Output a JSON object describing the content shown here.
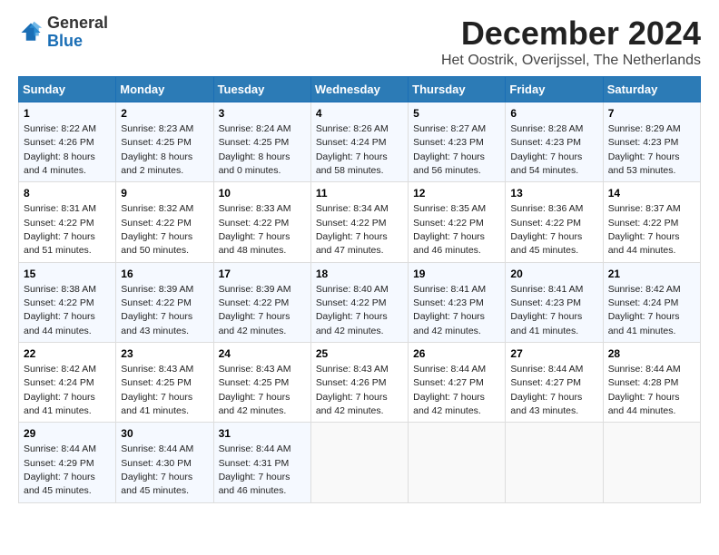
{
  "logo": {
    "general": "General",
    "blue": "Blue"
  },
  "title": "December 2024",
  "subtitle": "Het Oostrik, Overijssel, The Netherlands",
  "days_of_week": [
    "Sunday",
    "Monday",
    "Tuesday",
    "Wednesday",
    "Thursday",
    "Friday",
    "Saturday"
  ],
  "weeks": [
    [
      {
        "day": 1,
        "sunrise": "8:22 AM",
        "sunset": "4:26 PM",
        "daylight": "8 hours and 4 minutes."
      },
      {
        "day": 2,
        "sunrise": "8:23 AM",
        "sunset": "4:25 PM",
        "daylight": "8 hours and 2 minutes."
      },
      {
        "day": 3,
        "sunrise": "8:24 AM",
        "sunset": "4:25 PM",
        "daylight": "8 hours and 0 minutes."
      },
      {
        "day": 4,
        "sunrise": "8:26 AM",
        "sunset": "4:24 PM",
        "daylight": "7 hours and 58 minutes."
      },
      {
        "day": 5,
        "sunrise": "8:27 AM",
        "sunset": "4:23 PM",
        "daylight": "7 hours and 56 minutes."
      },
      {
        "day": 6,
        "sunrise": "8:28 AM",
        "sunset": "4:23 PM",
        "daylight": "7 hours and 54 minutes."
      },
      {
        "day": 7,
        "sunrise": "8:29 AM",
        "sunset": "4:23 PM",
        "daylight": "7 hours and 53 minutes."
      }
    ],
    [
      {
        "day": 8,
        "sunrise": "8:31 AM",
        "sunset": "4:22 PM",
        "daylight": "7 hours and 51 minutes."
      },
      {
        "day": 9,
        "sunrise": "8:32 AM",
        "sunset": "4:22 PM",
        "daylight": "7 hours and 50 minutes."
      },
      {
        "day": 10,
        "sunrise": "8:33 AM",
        "sunset": "4:22 PM",
        "daylight": "7 hours and 48 minutes."
      },
      {
        "day": 11,
        "sunrise": "8:34 AM",
        "sunset": "4:22 PM",
        "daylight": "7 hours and 47 minutes."
      },
      {
        "day": 12,
        "sunrise": "8:35 AM",
        "sunset": "4:22 PM",
        "daylight": "7 hours and 46 minutes."
      },
      {
        "day": 13,
        "sunrise": "8:36 AM",
        "sunset": "4:22 PM",
        "daylight": "7 hours and 45 minutes."
      },
      {
        "day": 14,
        "sunrise": "8:37 AM",
        "sunset": "4:22 PM",
        "daylight": "7 hours and 44 minutes."
      }
    ],
    [
      {
        "day": 15,
        "sunrise": "8:38 AM",
        "sunset": "4:22 PM",
        "daylight": "7 hours and 44 minutes."
      },
      {
        "day": 16,
        "sunrise": "8:39 AM",
        "sunset": "4:22 PM",
        "daylight": "7 hours and 43 minutes."
      },
      {
        "day": 17,
        "sunrise": "8:39 AM",
        "sunset": "4:22 PM",
        "daylight": "7 hours and 42 minutes."
      },
      {
        "day": 18,
        "sunrise": "8:40 AM",
        "sunset": "4:22 PM",
        "daylight": "7 hours and 42 minutes."
      },
      {
        "day": 19,
        "sunrise": "8:41 AM",
        "sunset": "4:23 PM",
        "daylight": "7 hours and 42 minutes."
      },
      {
        "day": 20,
        "sunrise": "8:41 AM",
        "sunset": "4:23 PM",
        "daylight": "7 hours and 41 minutes."
      },
      {
        "day": 21,
        "sunrise": "8:42 AM",
        "sunset": "4:24 PM",
        "daylight": "7 hours and 41 minutes."
      }
    ],
    [
      {
        "day": 22,
        "sunrise": "8:42 AM",
        "sunset": "4:24 PM",
        "daylight": "7 hours and 41 minutes."
      },
      {
        "day": 23,
        "sunrise": "8:43 AM",
        "sunset": "4:25 PM",
        "daylight": "7 hours and 41 minutes."
      },
      {
        "day": 24,
        "sunrise": "8:43 AM",
        "sunset": "4:25 PM",
        "daylight": "7 hours and 42 minutes."
      },
      {
        "day": 25,
        "sunrise": "8:43 AM",
        "sunset": "4:26 PM",
        "daylight": "7 hours and 42 minutes."
      },
      {
        "day": 26,
        "sunrise": "8:44 AM",
        "sunset": "4:27 PM",
        "daylight": "7 hours and 42 minutes."
      },
      {
        "day": 27,
        "sunrise": "8:44 AM",
        "sunset": "4:27 PM",
        "daylight": "7 hours and 43 minutes."
      },
      {
        "day": 28,
        "sunrise": "8:44 AM",
        "sunset": "4:28 PM",
        "daylight": "7 hours and 44 minutes."
      }
    ],
    [
      {
        "day": 29,
        "sunrise": "8:44 AM",
        "sunset": "4:29 PM",
        "daylight": "7 hours and 45 minutes."
      },
      {
        "day": 30,
        "sunrise": "8:44 AM",
        "sunset": "4:30 PM",
        "daylight": "7 hours and 45 minutes."
      },
      {
        "day": 31,
        "sunrise": "8:44 AM",
        "sunset": "4:31 PM",
        "daylight": "7 hours and 46 minutes."
      },
      null,
      null,
      null,
      null
    ]
  ],
  "labels": {
    "sunrise": "Sunrise:",
    "sunset": "Sunset:",
    "daylight": "Daylight:"
  }
}
